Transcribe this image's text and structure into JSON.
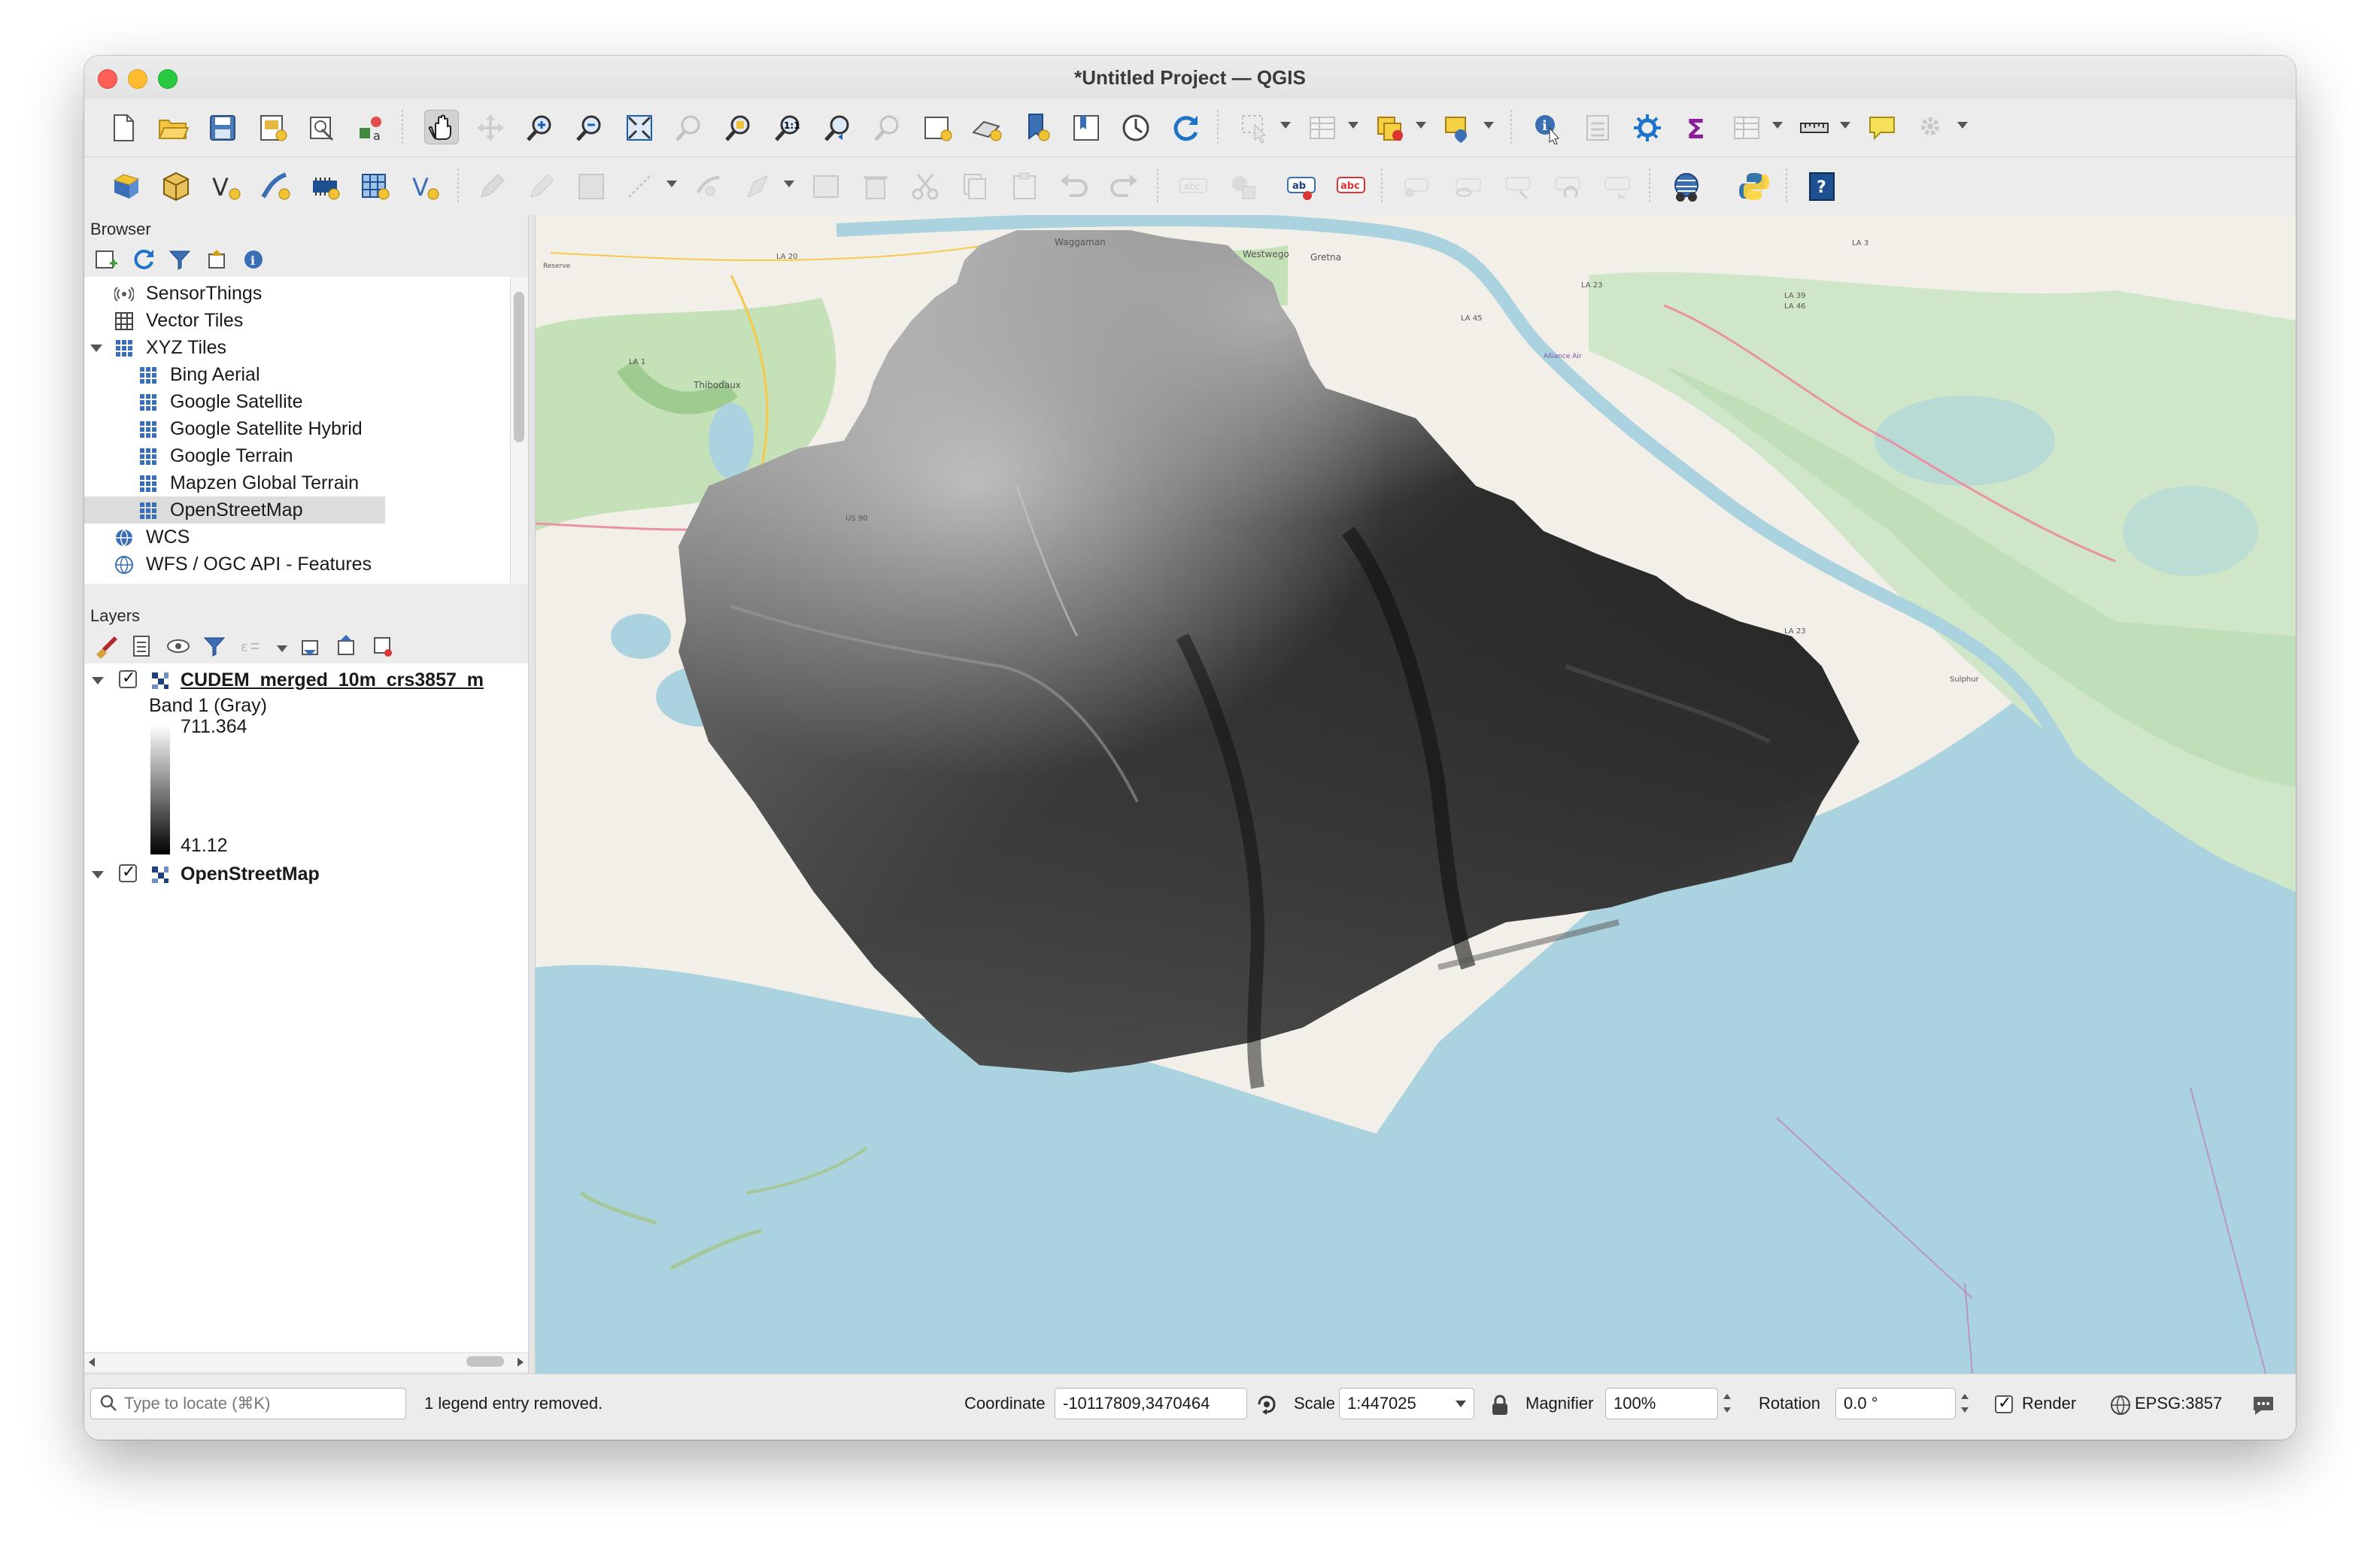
{
  "window": {
    "title": "*Untitled Project — QGIS"
  },
  "toolbar1": {
    "tools": [
      "new-project",
      "open-project",
      "save-project",
      "new-print-layout",
      "layout-manager",
      "style-manager",
      "pan-map",
      "pan-to-selection",
      "zoom-in",
      "zoom-out",
      "zoom-full",
      "zoom-to-selection",
      "zoom-to-layer",
      "zoom-native",
      "zoom-last",
      "zoom-next",
      "new-map-view",
      "new-3d-map-view",
      "new-bookmark",
      "show-bookmarks",
      "temporal-controller",
      "refresh",
      "select-features",
      "open-attribute-table",
      "deselect",
      "select-by-location",
      "identify-features",
      "open-field-calculator",
      "processing-toolbox",
      "statistical-summary",
      "attribute-table",
      "measure-line",
      "map-tips",
      "settings"
    ]
  },
  "toolbar2": {
    "tools": [
      "data-source-manager",
      "new-geopackage-layer",
      "new-shapefile-layer",
      "new-spatialite-layer",
      "new-temporary-scratch-layer",
      "new-virtual-layer",
      "toggle-editing",
      "current-edits",
      "save-layer-edits",
      "digitize",
      "add-feature",
      "vertex-tool",
      "modify-attributes",
      "delete-selected",
      "cut-features",
      "copy-features",
      "paste-features",
      "undo",
      "redo",
      "label-toolbar",
      "pin-labels",
      "highlight-pinned-labels",
      "layer-labeling-options",
      "show-hide-labels",
      "move-label",
      "rotate-label",
      "change-label",
      "quickmapservices",
      "python-console",
      "help"
    ]
  },
  "browser": {
    "title": "Browser",
    "items": [
      {
        "label": "SensorThings",
        "icon": "sensorthings-icon",
        "indent": 0
      },
      {
        "label": "Vector Tiles",
        "icon": "vector-tiles-icon",
        "indent": 0
      },
      {
        "label": "XYZ Tiles",
        "icon": "xyz-tiles-icon",
        "indent": 0,
        "expanded": true
      },
      {
        "label": "Bing Aerial",
        "icon": "xyz-tile-icon",
        "indent": 1
      },
      {
        "label": "Google Satellite",
        "icon": "xyz-tile-icon",
        "indent": 1
      },
      {
        "label": "Google Satellite Hybrid",
        "icon": "xyz-tile-icon",
        "indent": 1
      },
      {
        "label": "Google Terrain",
        "icon": "xyz-tile-icon",
        "indent": 1
      },
      {
        "label": "Mapzen Global Terrain",
        "icon": "xyz-tile-icon",
        "indent": 1
      },
      {
        "label": "OpenStreetMap",
        "icon": "xyz-tile-icon",
        "indent": 1,
        "selected": true
      },
      {
        "label": "WCS",
        "icon": "wcs-icon",
        "indent": 0
      },
      {
        "label": "WFS / OGC API - Features",
        "icon": "wfs-icon",
        "indent": 0
      }
    ]
  },
  "layers": {
    "title": "Layers",
    "raster_layer": {
      "name": "CUDEM_merged_10m_crs3857_m",
      "band": "Band 1 (Gray)",
      "max": "711.364",
      "min": "41.12",
      "checked": true
    },
    "base_layer": {
      "name": "OpenStreetMap",
      "checked": true
    }
  },
  "map": {
    "labels": [
      "Waggaman",
      "Westwego",
      "Gretna",
      "Thibodaux",
      "LA 20",
      "LA 1",
      "LA 45",
      "LA 23",
      "LA 39",
      "LA 46",
      "US 90",
      "LA 3",
      "Alliance Air",
      "Reserve",
      "Sulphur",
      "LA 23"
    ]
  },
  "statusbar": {
    "locate_placeholder": "Type to locate (⌘K)",
    "message": "1 legend entry removed.",
    "coordinate_label": "Coordinate",
    "coordinate_value": "-10117809,3470464",
    "scale_label": "Scale",
    "scale_value": "1:447025",
    "magnifier_label": "Magnifier",
    "magnifier_value": "100%",
    "rotation_label": "Rotation",
    "rotation_value": "0.0 °",
    "render_label": "Render",
    "render_checked": true,
    "crs": "EPSG:3857"
  }
}
